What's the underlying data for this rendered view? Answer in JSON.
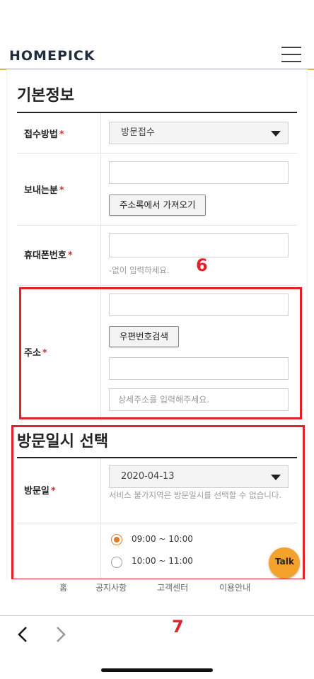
{
  "header": {
    "logo": "HOMEPICK",
    "menu_icon": "hamburger-menu-icon"
  },
  "basic_info": {
    "title": "기본정보",
    "receive_method": {
      "label": "접수방법",
      "value": "방문접수"
    },
    "sender": {
      "label": "보내는분",
      "value": "",
      "address_book_button": "주소록에서 가져오기"
    },
    "mobile": {
      "label": "휴대폰번호",
      "value": "",
      "hint": "-없이 입력하세요."
    },
    "address": {
      "label": "주소",
      "zip_value": "",
      "zip_search_button": "우편번호검색",
      "address_value": "",
      "detail_placeholder": "상세주소를 입력해주세요."
    }
  },
  "visit": {
    "title": "방문일시 선택",
    "date": {
      "label": "방문일",
      "value": "2020-04-13",
      "notice": "서비스 불가지역은 방문일시를 선택할 수 없습니다."
    },
    "times": [
      {
        "label": "09:00 ~ 10:00",
        "selected": true
      },
      {
        "label": "10:00 ~ 11:00",
        "selected": false
      }
    ]
  },
  "required_mark": "*",
  "annotations": {
    "box6": "6",
    "box7": "7"
  },
  "talk_button": "Talk",
  "footer": {
    "links": [
      "홈",
      "공지사항",
      "고객센터",
      "이용안내"
    ]
  },
  "browser_nav": {
    "back_icon": "chevron-left-icon",
    "forward_icon": "chevron-right-icon"
  },
  "colors": {
    "accent": "#e0b24a",
    "required": "#d8332f",
    "annotation": "#e0222a",
    "radio": "#e27a2e",
    "talk": "#f3a32b"
  }
}
